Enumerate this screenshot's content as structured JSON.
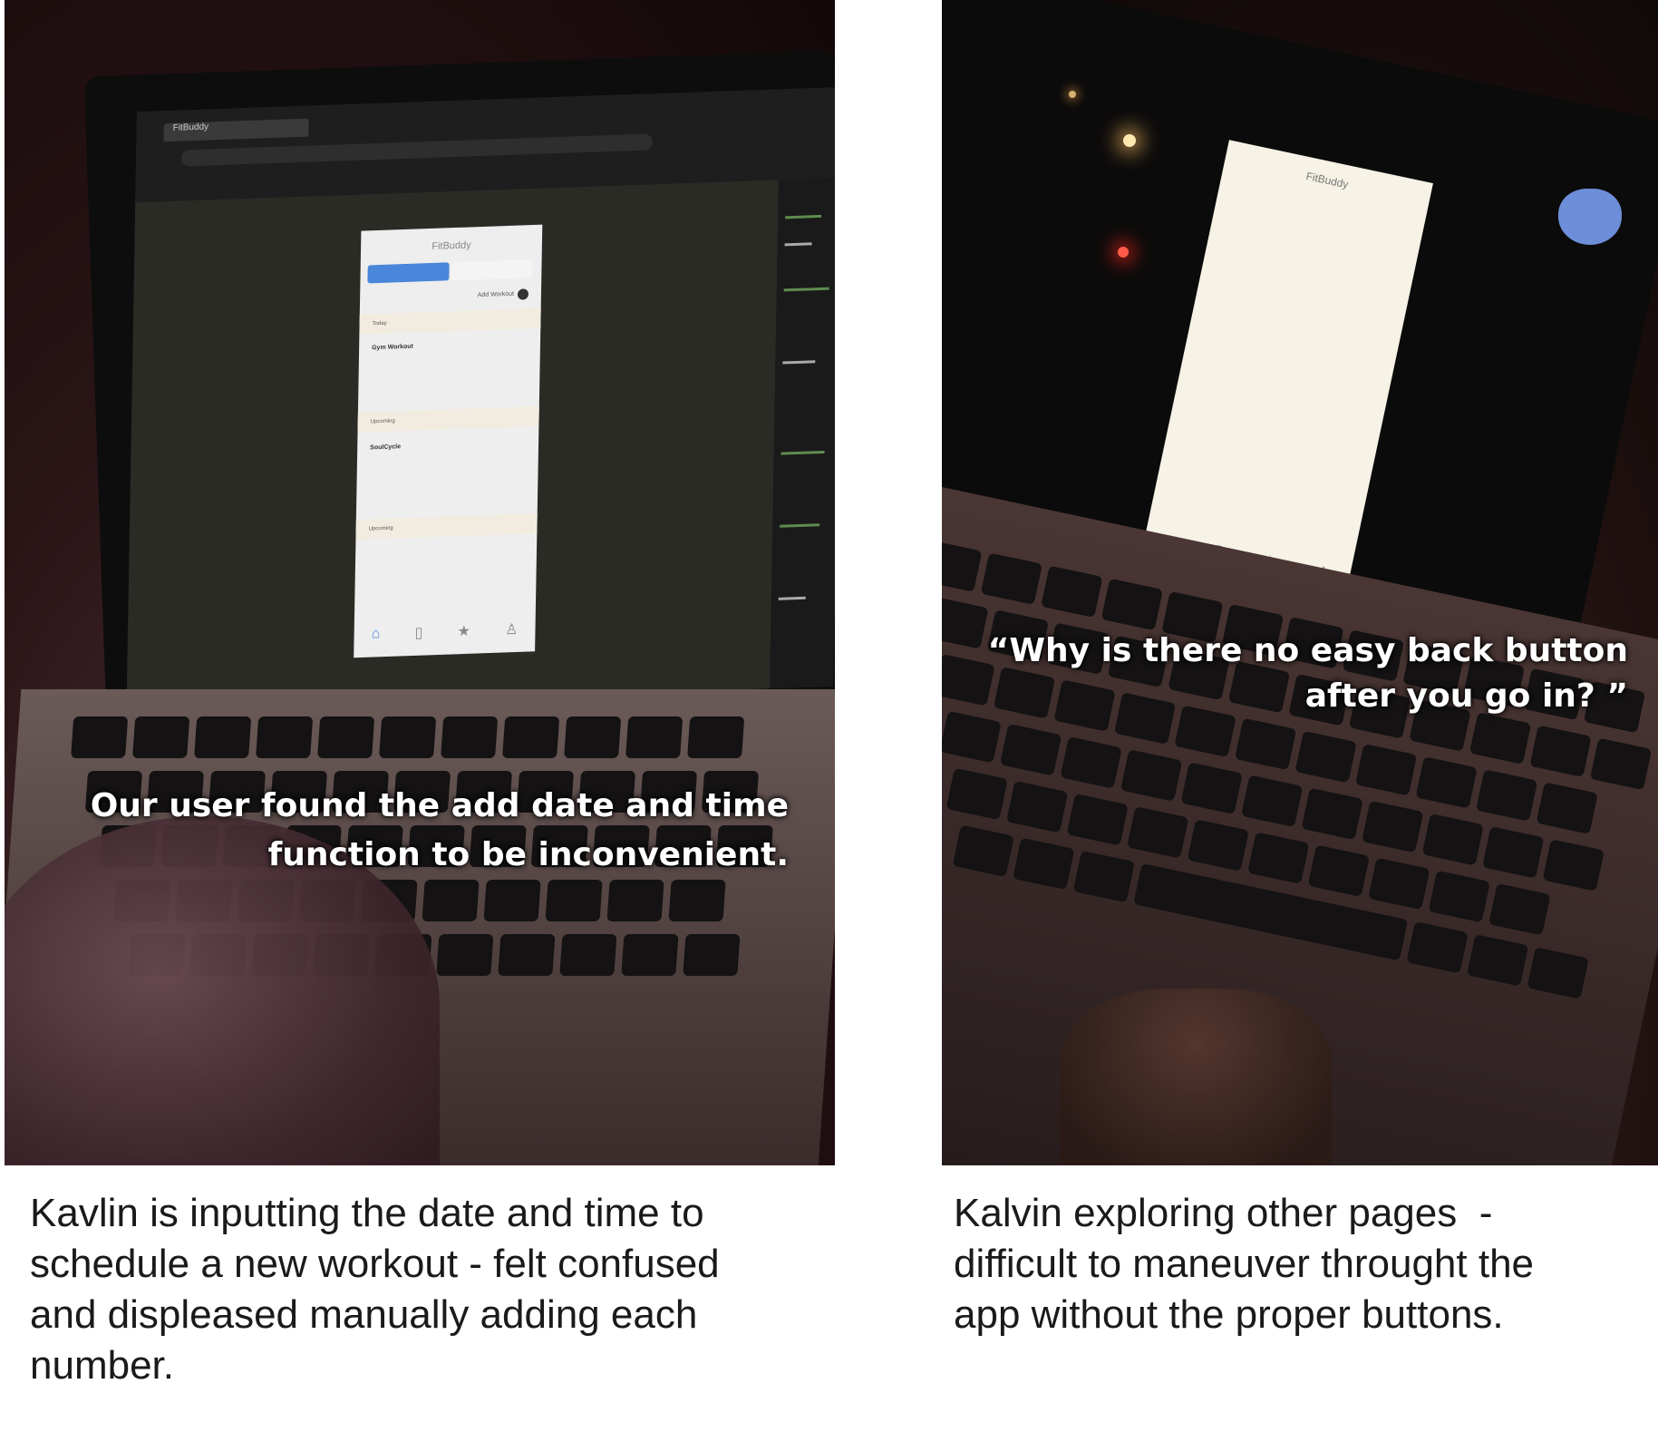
{
  "left_photo": {
    "caption_lines": [
      "Our user found the add date and time",
      "function to be inconvenient."
    ],
    "screen": {
      "tab_title": "FitBuddy",
      "app_title": "FitBuddy",
      "segments": [
        "",
        ""
      ],
      "add_workout": "Add Workout",
      "sections": [
        {
          "header": "Today",
          "title": "Gym Workout",
          "lines": [
            "",
            ""
          ]
        },
        {
          "header": "Upcoming",
          "title": "SoulCycle",
          "lines": [
            "",
            ""
          ]
        },
        {
          "header": "Upcoming",
          "title": "",
          "lines": []
        }
      ]
    },
    "description_lines": [
      "Kavlin is inputting the date and time to",
      "schedule a new workout - felt confused",
      "and displeased manually adding each",
      "number."
    ]
  },
  "right_photo": {
    "caption_lines": [
      "“Why is there no easy back button",
      "after you go in? ”"
    ],
    "screen": {
      "app_title": "FitBuddy"
    },
    "description_lines": [
      "Kalvin exploring other pages  -",
      "difficult to maneuver throught the",
      "app without the proper buttons."
    ]
  },
  "icons": [
    "home-icon",
    "bookmark-icon",
    "star-icon",
    "user-icon"
  ]
}
